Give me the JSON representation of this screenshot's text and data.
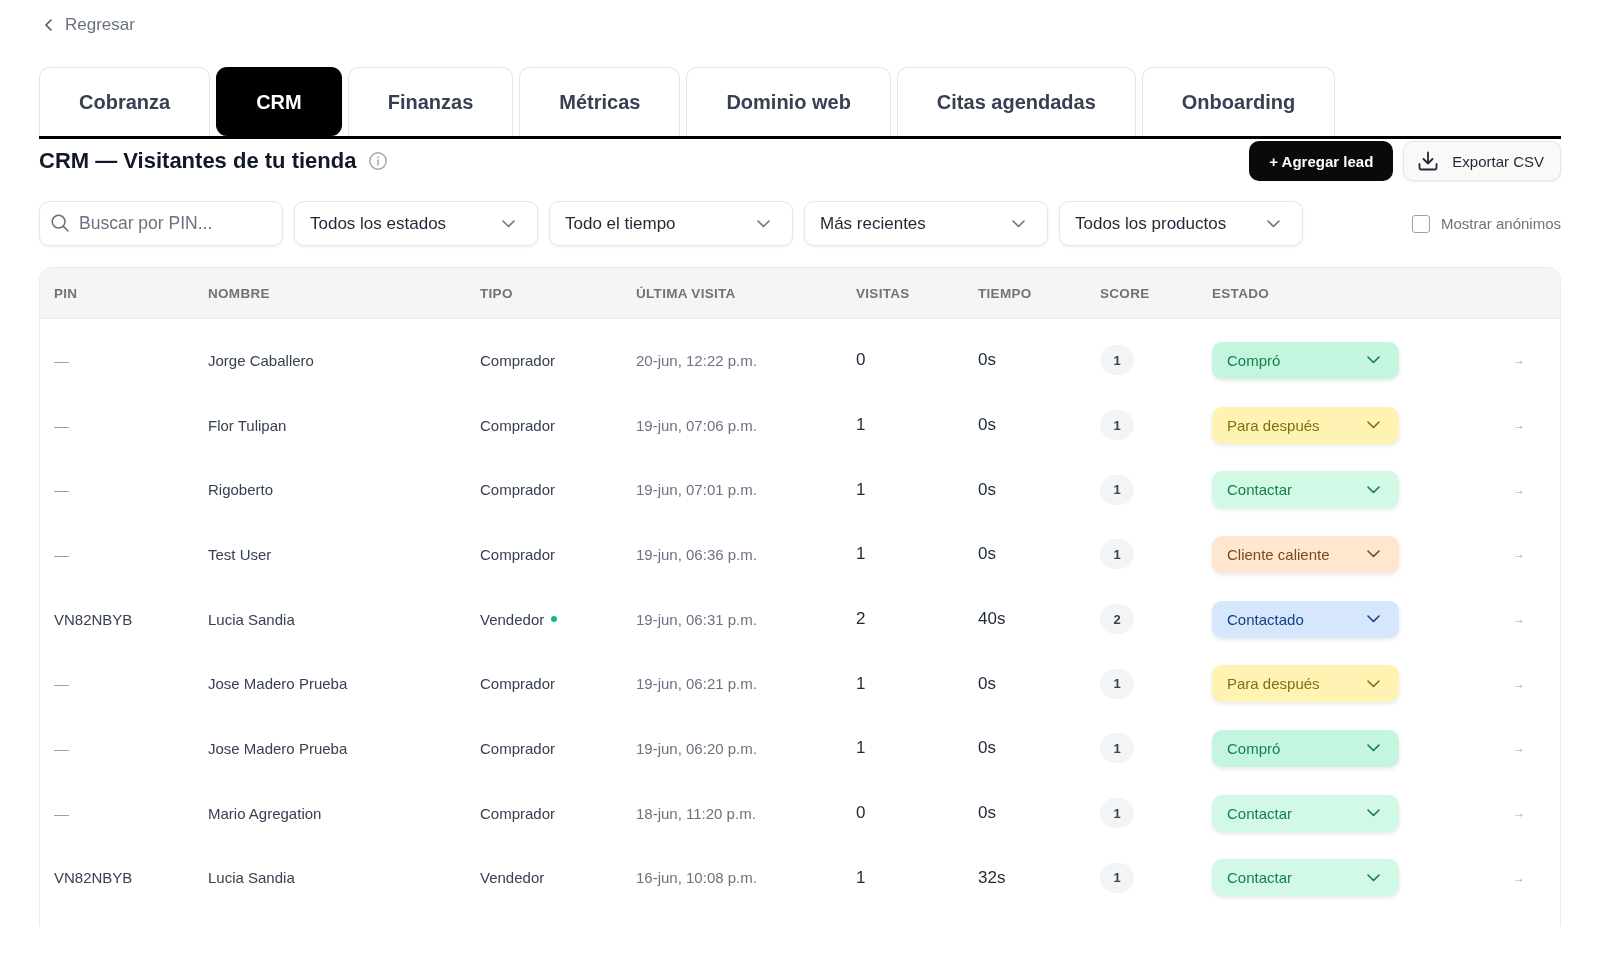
{
  "back_link": {
    "label": "Regresar"
  },
  "tabs": [
    {
      "label": "Cobranza",
      "selected": false
    },
    {
      "label": "CRM",
      "selected": true
    },
    {
      "label": "Finanzas",
      "selected": false
    },
    {
      "label": "Métricas",
      "selected": false
    },
    {
      "label": "Dominio web",
      "selected": false
    },
    {
      "label": "Citas agendadas",
      "selected": false
    },
    {
      "label": "Onboarding",
      "selected": false
    }
  ],
  "header": {
    "title": "CRM — Visitantes de tu tienda",
    "buttons": [
      {
        "label": "+ Agregar lead",
        "kind": "primary"
      },
      {
        "label": "Exportar CSV",
        "kind": "export"
      }
    ]
  },
  "filters": {
    "search": {
      "placeholder": "Buscar por PIN..."
    },
    "dropdowns": [
      {
        "value": "Todos los estados"
      },
      {
        "value": "Todo el tiempo"
      },
      {
        "value": "Más recientes"
      },
      {
        "value": "Todos los productos"
      }
    ],
    "show_anonymous": {
      "label": "Mostrar anónimos",
      "checked": false
    }
  },
  "table": {
    "columns": [
      "PIN",
      "NOMBRE",
      "TIPO",
      "ÚLTIMA VISITA",
      "VISITAS",
      "TIEMPO",
      "SCORE",
      "ESTADO"
    ],
    "rows": [
      {
        "pin": "—",
        "name": "Jorge Caballero",
        "type": "Comprador",
        "online": false,
        "last_visit": "20-jun, 12:22 p.m.",
        "visits": "0",
        "time": "0s",
        "score": "1",
        "status": {
          "label": "Compró",
          "color": "#c4f5df"
        },
        "action": "→"
      },
      {
        "pin": "—",
        "name": "Flor Tulipan",
        "type": "Comprador",
        "online": false,
        "last_visit": "19-jun, 07:06 p.m.",
        "visits": "1",
        "time": "0s",
        "score": "1",
        "status": {
          "label": "Para después",
          "color": "#fef3b3"
        },
        "action": "→"
      },
      {
        "pin": "—",
        "name": "Rigoberto",
        "type": "Comprador",
        "online": false,
        "last_visit": "19-jun, 07:01 p.m.",
        "visits": "1",
        "time": "0s",
        "score": "1",
        "status": {
          "label": "Contactar",
          "color": "#d2f8e6"
        },
        "action": "→"
      },
      {
        "pin": "—",
        "name": "Test User",
        "type": "Comprador",
        "online": false,
        "last_visit": "19-jun, 06:36 p.m.",
        "visits": "1",
        "time": "0s",
        "score": "1",
        "status": {
          "label": "Cliente caliente",
          "color": "#fee6cf"
        },
        "action": "→"
      },
      {
        "pin": "VN82NBYB",
        "name": "Lucia Sandia",
        "type": "Vendedor",
        "online": true,
        "last_visit": "19-jun, 06:31 p.m.",
        "visits": "2",
        "time": "40s",
        "score": "2",
        "status": {
          "label": "Contactado",
          "color": "#d5e6fd"
        },
        "action": "→"
      },
      {
        "pin": "—",
        "name": "Jose Madero Prueba",
        "type": "Comprador",
        "online": false,
        "last_visit": "19-jun, 06:21 p.m.",
        "visits": "1",
        "time": "0s",
        "score": "1",
        "status": {
          "label": "Para después",
          "color": "#fef3b3"
        },
        "action": "→"
      },
      {
        "pin": "—",
        "name": "Jose Madero Prueba",
        "type": "Comprador",
        "online": false,
        "last_visit": "19-jun, 06:20 p.m.",
        "visits": "1",
        "time": "0s",
        "score": "1",
        "status": {
          "label": "Compró",
          "color": "#c4f5df"
        },
        "action": "→"
      },
      {
        "pin": "—",
        "name": "Mario Agregation",
        "type": "Comprador",
        "online": false,
        "last_visit": "18-jun, 11:20 p.m.",
        "visits": "0",
        "time": "0s",
        "score": "1",
        "status": {
          "label": "Contactar",
          "color": "#d2f8e6"
        },
        "action": "→"
      },
      {
        "pin": "VN82NBYB",
        "name": "Lucia Sandia",
        "type": "Vendedor",
        "online": false,
        "last_visit": "16-jun, 10:08 p.m.",
        "visits": "1",
        "time": "32s",
        "score": "1",
        "status": {
          "label": "Contactar",
          "color": "#d2f8e6"
        },
        "action": "→"
      }
    ]
  }
}
